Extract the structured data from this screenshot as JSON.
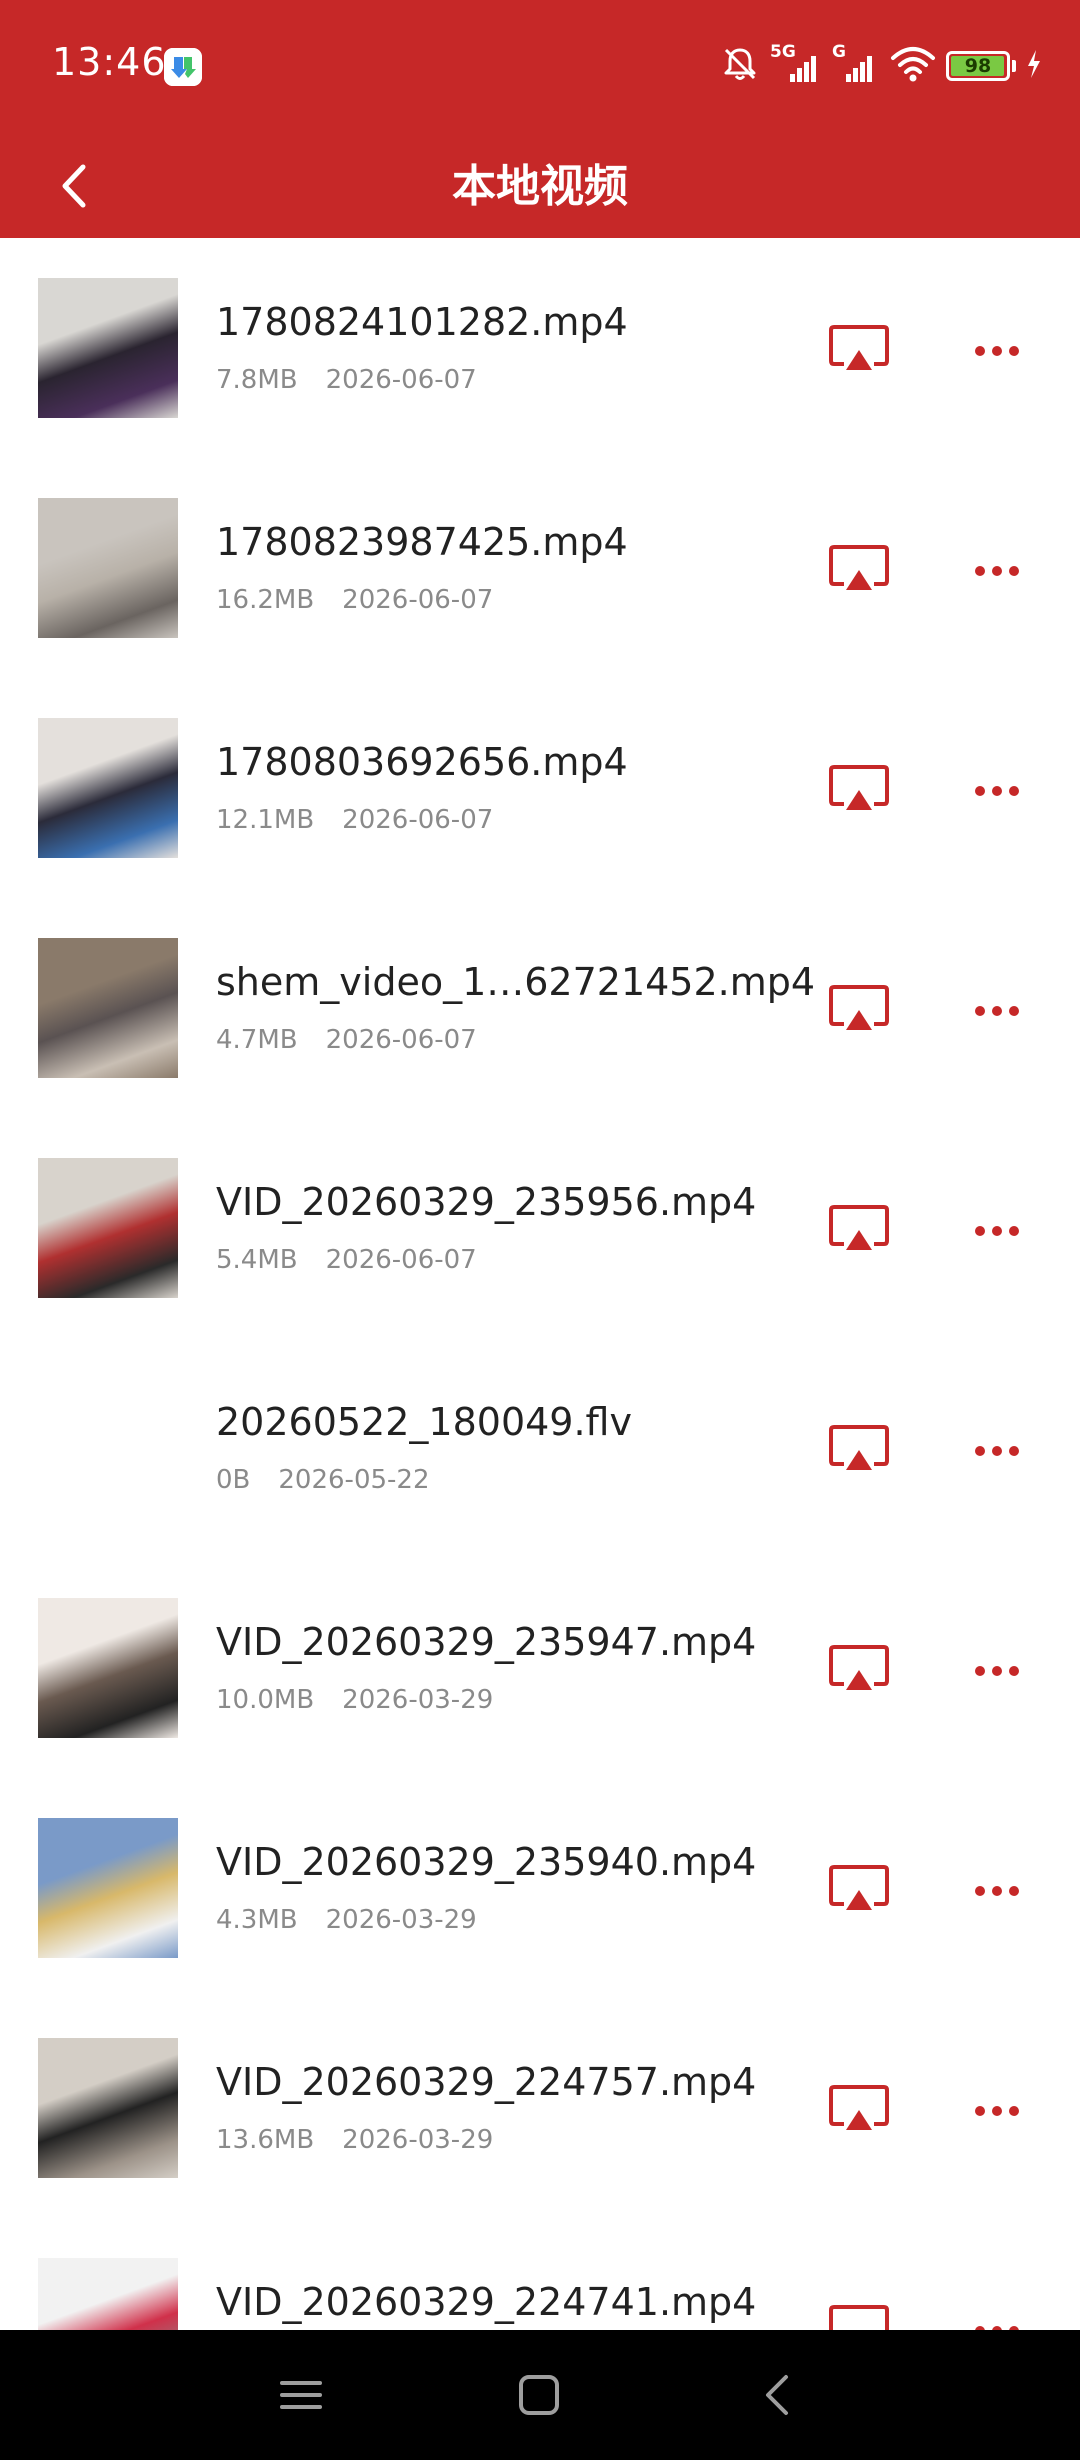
{
  "status_bar": {
    "time": "13:46",
    "battery_level": "98",
    "battery_fraction": 0.98,
    "network_primary": "5G",
    "network_secondary": "G",
    "icons": [
      "app-download-icon",
      "mute-bell-icon",
      "signal-5g-icon",
      "signal-g-icon",
      "wifi-icon",
      "battery-icon",
      "charging-bolt-icon"
    ]
  },
  "header": {
    "title": "本地视频",
    "back_icon": "chevron-left-icon"
  },
  "colors": {
    "accent": "#c62828",
    "text_primary": "#222222",
    "text_secondary": "#8a8a8a",
    "battery_fill": "#7ac943"
  },
  "videos": [
    {
      "name": "1780824101282.mp4",
      "size": "7.8MB",
      "date": "2026-06-07",
      "has_thumbnail": true
    },
    {
      "name": "1780823987425.mp4",
      "size": "16.2MB",
      "date": "2026-06-07",
      "has_thumbnail": true
    },
    {
      "name": "1780803692656.mp4",
      "size": "12.1MB",
      "date": "2026-06-07",
      "has_thumbnail": true
    },
    {
      "name": "shem_video_1…62721452.mp4",
      "size": "4.7MB",
      "date": "2026-06-07",
      "has_thumbnail": true
    },
    {
      "name": "VID_20260329_235956.mp4",
      "size": "5.4MB",
      "date": "2026-06-07",
      "has_thumbnail": true
    },
    {
      "name": "20260522_180049.flv",
      "size": "0B",
      "date": "2026-05-22",
      "has_thumbnail": false
    },
    {
      "name": "VID_20260329_235947.mp4",
      "size": "10.0MB",
      "date": "2026-03-29",
      "has_thumbnail": true
    },
    {
      "name": "VID_20260329_235940.mp4",
      "size": "4.3MB",
      "date": "2026-03-29",
      "has_thumbnail": true
    },
    {
      "name": "VID_20260329_224757.mp4",
      "size": "13.6MB",
      "date": "2026-03-29",
      "has_thumbnail": true
    },
    {
      "name": "VID_20260329_224741.mp4",
      "size": "",
      "date": "",
      "has_thumbnail": true
    }
  ],
  "row_icons": {
    "cast": "screen-cast-icon",
    "more": "more-dots-icon"
  },
  "nav_bar": {
    "icons": [
      "menu-icon",
      "home-icon",
      "back-icon"
    ]
  }
}
